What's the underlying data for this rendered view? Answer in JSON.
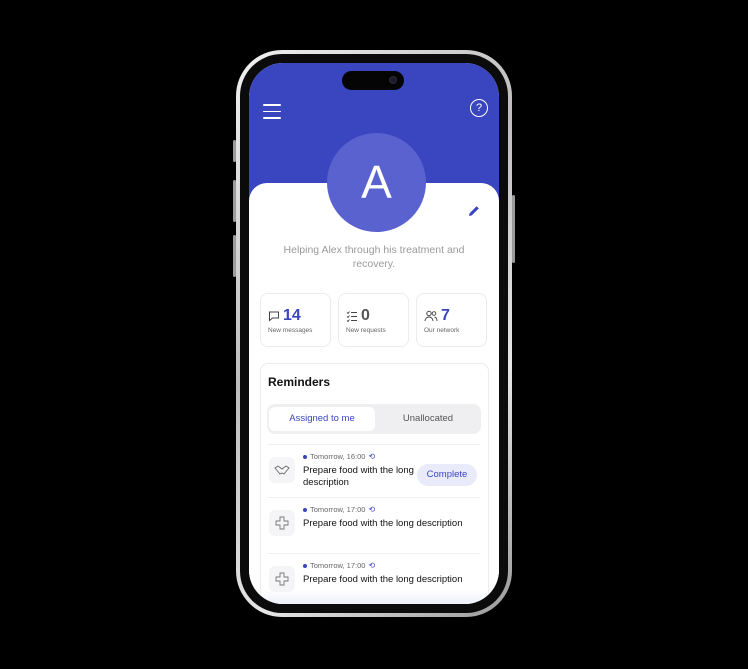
{
  "header": {
    "menu_icon": "hamburger-icon",
    "help_icon": "question-circle-icon",
    "accent_color": "#3a45c0"
  },
  "profile": {
    "avatar_letter": "A",
    "tagline": "Helping Alex through his treatment and recovery."
  },
  "stats": [
    {
      "icon": "chat-bubble-icon",
      "value": "14",
      "label": "New messages"
    },
    {
      "icon": "checklist-icon",
      "value": "0",
      "label": "New requests"
    },
    {
      "icon": "people-icon",
      "value": "7",
      "label": "Our network"
    }
  ],
  "reminders": {
    "title": "Reminders",
    "tabs": [
      {
        "label": "Assigned to me",
        "active": true
      },
      {
        "label": "Unallocated",
        "active": false
      }
    ],
    "items": [
      {
        "icon": "handshake-icon",
        "time": "Tomorrow, 16:00",
        "title": "Prepare food with the long description",
        "action": "Complete"
      },
      {
        "icon": "medical-cross-icon",
        "time": "Tomorrow, 17:00",
        "title": "Prepare food with the long description"
      },
      {
        "icon": "medical-cross-icon",
        "time": "Tomorrow, 17:00",
        "title": "Prepare food with the long description"
      }
    ]
  }
}
